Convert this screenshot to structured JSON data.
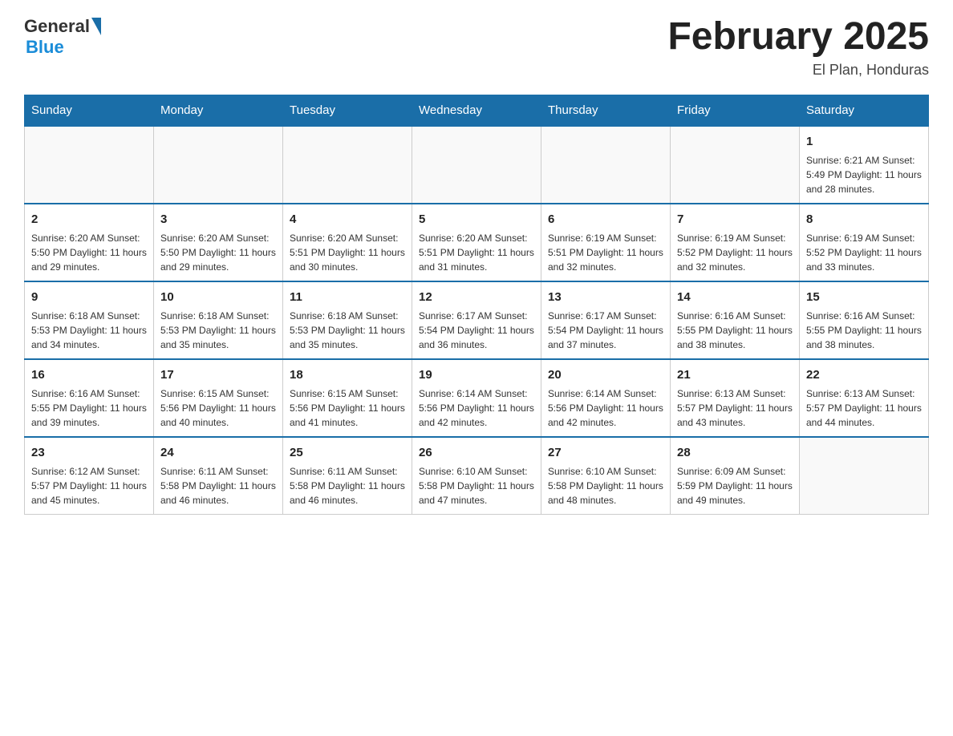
{
  "logo": {
    "general_text": "General",
    "blue_text": "Blue"
  },
  "title": "February 2025",
  "location": "El Plan, Honduras",
  "weekdays": [
    "Sunday",
    "Monday",
    "Tuesday",
    "Wednesday",
    "Thursday",
    "Friday",
    "Saturday"
  ],
  "weeks": [
    [
      {
        "day": "",
        "info": ""
      },
      {
        "day": "",
        "info": ""
      },
      {
        "day": "",
        "info": ""
      },
      {
        "day": "",
        "info": ""
      },
      {
        "day": "",
        "info": ""
      },
      {
        "day": "",
        "info": ""
      },
      {
        "day": "1",
        "info": "Sunrise: 6:21 AM\nSunset: 5:49 PM\nDaylight: 11 hours and 28 minutes."
      }
    ],
    [
      {
        "day": "2",
        "info": "Sunrise: 6:20 AM\nSunset: 5:50 PM\nDaylight: 11 hours and 29 minutes."
      },
      {
        "day": "3",
        "info": "Sunrise: 6:20 AM\nSunset: 5:50 PM\nDaylight: 11 hours and 29 minutes."
      },
      {
        "day": "4",
        "info": "Sunrise: 6:20 AM\nSunset: 5:51 PM\nDaylight: 11 hours and 30 minutes."
      },
      {
        "day": "5",
        "info": "Sunrise: 6:20 AM\nSunset: 5:51 PM\nDaylight: 11 hours and 31 minutes."
      },
      {
        "day": "6",
        "info": "Sunrise: 6:19 AM\nSunset: 5:51 PM\nDaylight: 11 hours and 32 minutes."
      },
      {
        "day": "7",
        "info": "Sunrise: 6:19 AM\nSunset: 5:52 PM\nDaylight: 11 hours and 32 minutes."
      },
      {
        "day": "8",
        "info": "Sunrise: 6:19 AM\nSunset: 5:52 PM\nDaylight: 11 hours and 33 minutes."
      }
    ],
    [
      {
        "day": "9",
        "info": "Sunrise: 6:18 AM\nSunset: 5:53 PM\nDaylight: 11 hours and 34 minutes."
      },
      {
        "day": "10",
        "info": "Sunrise: 6:18 AM\nSunset: 5:53 PM\nDaylight: 11 hours and 35 minutes."
      },
      {
        "day": "11",
        "info": "Sunrise: 6:18 AM\nSunset: 5:53 PM\nDaylight: 11 hours and 35 minutes."
      },
      {
        "day": "12",
        "info": "Sunrise: 6:17 AM\nSunset: 5:54 PM\nDaylight: 11 hours and 36 minutes."
      },
      {
        "day": "13",
        "info": "Sunrise: 6:17 AM\nSunset: 5:54 PM\nDaylight: 11 hours and 37 minutes."
      },
      {
        "day": "14",
        "info": "Sunrise: 6:16 AM\nSunset: 5:55 PM\nDaylight: 11 hours and 38 minutes."
      },
      {
        "day": "15",
        "info": "Sunrise: 6:16 AM\nSunset: 5:55 PM\nDaylight: 11 hours and 38 minutes."
      }
    ],
    [
      {
        "day": "16",
        "info": "Sunrise: 6:16 AM\nSunset: 5:55 PM\nDaylight: 11 hours and 39 minutes."
      },
      {
        "day": "17",
        "info": "Sunrise: 6:15 AM\nSunset: 5:56 PM\nDaylight: 11 hours and 40 minutes."
      },
      {
        "day": "18",
        "info": "Sunrise: 6:15 AM\nSunset: 5:56 PM\nDaylight: 11 hours and 41 minutes."
      },
      {
        "day": "19",
        "info": "Sunrise: 6:14 AM\nSunset: 5:56 PM\nDaylight: 11 hours and 42 minutes."
      },
      {
        "day": "20",
        "info": "Sunrise: 6:14 AM\nSunset: 5:56 PM\nDaylight: 11 hours and 42 minutes."
      },
      {
        "day": "21",
        "info": "Sunrise: 6:13 AM\nSunset: 5:57 PM\nDaylight: 11 hours and 43 minutes."
      },
      {
        "day": "22",
        "info": "Sunrise: 6:13 AM\nSunset: 5:57 PM\nDaylight: 11 hours and 44 minutes."
      }
    ],
    [
      {
        "day": "23",
        "info": "Sunrise: 6:12 AM\nSunset: 5:57 PM\nDaylight: 11 hours and 45 minutes."
      },
      {
        "day": "24",
        "info": "Sunrise: 6:11 AM\nSunset: 5:58 PM\nDaylight: 11 hours and 46 minutes."
      },
      {
        "day": "25",
        "info": "Sunrise: 6:11 AM\nSunset: 5:58 PM\nDaylight: 11 hours and 46 minutes."
      },
      {
        "day": "26",
        "info": "Sunrise: 6:10 AM\nSunset: 5:58 PM\nDaylight: 11 hours and 47 minutes."
      },
      {
        "day": "27",
        "info": "Sunrise: 6:10 AM\nSunset: 5:58 PM\nDaylight: 11 hours and 48 minutes."
      },
      {
        "day": "28",
        "info": "Sunrise: 6:09 AM\nSunset: 5:59 PM\nDaylight: 11 hours and 49 minutes."
      },
      {
        "day": "",
        "info": ""
      }
    ]
  ]
}
